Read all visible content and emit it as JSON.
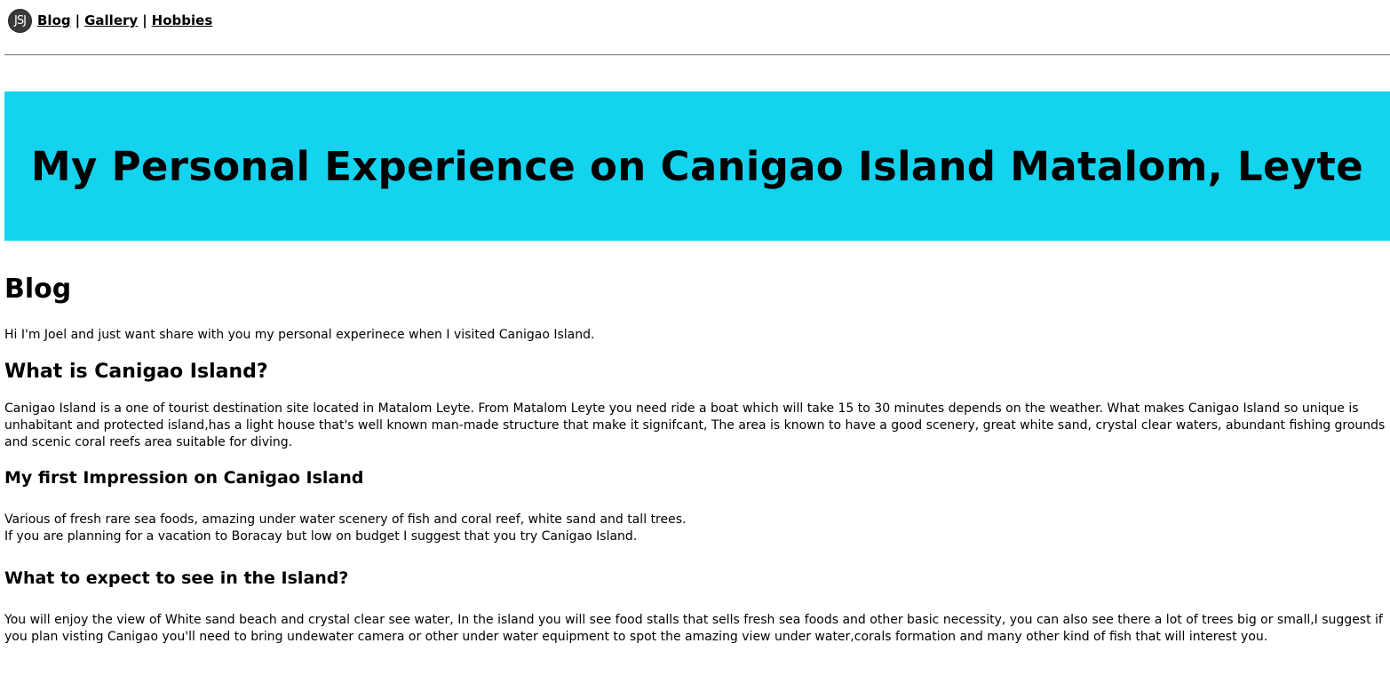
{
  "nav": {
    "logo_text": "JSJ",
    "links": [
      "Blog",
      "Gallery",
      "Hobbies"
    ],
    "separator": "|"
  },
  "banner": {
    "title": "My Personal Experience on Canigao Island Matalom, Leyte",
    "background": "#14d3ee"
  },
  "blog": {
    "heading": "Blog",
    "intro": "Hi I'm Joel and just want share with you my personal experinece when I visited Canigao Island.",
    "sections": [
      {
        "heading": "What is Canigao Island?",
        "paragraphs": [
          "Canigao Island is a one of tourist destination site located in Matalom Leyte. From Matalom Leyte you need ride a boat which will take 15 to 30 minutes depends on the weather. What makes Canigao Island so unique is unhabitant and protected island,has a light house that's well known man-made structure that make it signifcant, The area is known to have a good scenery, great white sand, crystal clear waters, abundant fishing grounds and scenic coral reefs area suitable for diving."
        ]
      },
      {
        "heading": "My first Impression on Canigao Island",
        "paragraphs": [
          "Various of fresh rare sea foods, amazing under water scenery of fish and coral reef, white sand and tall trees.",
          "If you are planning for a vacation to Boracay but low on budget I suggest that you try Canigao Island."
        ]
      },
      {
        "heading": "What to expect to see in the Island?",
        "paragraphs": [
          "You will enjoy the view of White sand beach and crystal clear see water, In the island you will see food stalls that sells fresh sea foods and other basic necessity, you can also see there a lot of trees big or small,I suggest if you plan visting Canigao you'll need to bring undewater camera or other under water equipment to spot the amazing view under water,corals formation and many other kind of fish that will interest you."
        ]
      }
    ]
  }
}
